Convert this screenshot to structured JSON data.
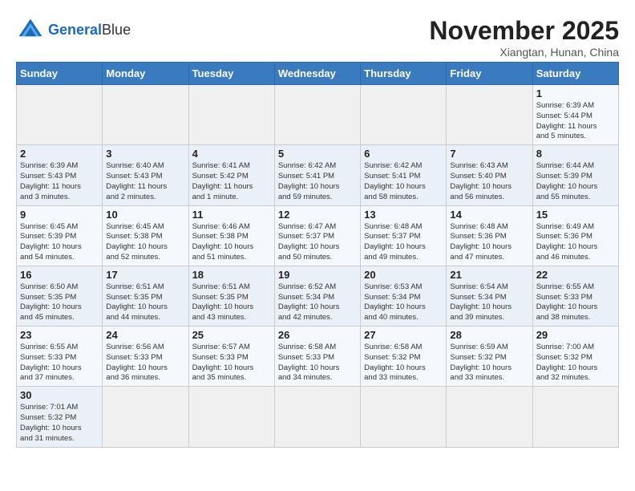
{
  "header": {
    "logo_general": "General",
    "logo_blue": "Blue",
    "month_title": "November 2025",
    "location": "Xiangtan, Hunan, China"
  },
  "weekdays": [
    "Sunday",
    "Monday",
    "Tuesday",
    "Wednesday",
    "Thursday",
    "Friday",
    "Saturday"
  ],
  "weeks": [
    [
      {
        "day": "",
        "info": ""
      },
      {
        "day": "",
        "info": ""
      },
      {
        "day": "",
        "info": ""
      },
      {
        "day": "",
        "info": ""
      },
      {
        "day": "",
        "info": ""
      },
      {
        "day": "",
        "info": ""
      },
      {
        "day": "1",
        "info": "Sunrise: 6:39 AM\nSunset: 5:44 PM\nDaylight: 11 hours\nand 5 minutes."
      }
    ],
    [
      {
        "day": "2",
        "info": "Sunrise: 6:39 AM\nSunset: 5:43 PM\nDaylight: 11 hours\nand 3 minutes."
      },
      {
        "day": "3",
        "info": "Sunrise: 6:40 AM\nSunset: 5:43 PM\nDaylight: 11 hours\nand 2 minutes."
      },
      {
        "day": "4",
        "info": "Sunrise: 6:41 AM\nSunset: 5:42 PM\nDaylight: 11 hours\nand 1 minute."
      },
      {
        "day": "5",
        "info": "Sunrise: 6:42 AM\nSunset: 5:41 PM\nDaylight: 10 hours\nand 59 minutes."
      },
      {
        "day": "6",
        "info": "Sunrise: 6:42 AM\nSunset: 5:41 PM\nDaylight: 10 hours\nand 58 minutes."
      },
      {
        "day": "7",
        "info": "Sunrise: 6:43 AM\nSunset: 5:40 PM\nDaylight: 10 hours\nand 56 minutes."
      },
      {
        "day": "8",
        "info": "Sunrise: 6:44 AM\nSunset: 5:39 PM\nDaylight: 10 hours\nand 55 minutes."
      }
    ],
    [
      {
        "day": "9",
        "info": "Sunrise: 6:45 AM\nSunset: 5:39 PM\nDaylight: 10 hours\nand 54 minutes."
      },
      {
        "day": "10",
        "info": "Sunrise: 6:45 AM\nSunset: 5:38 PM\nDaylight: 10 hours\nand 52 minutes."
      },
      {
        "day": "11",
        "info": "Sunrise: 6:46 AM\nSunset: 5:38 PM\nDaylight: 10 hours\nand 51 minutes."
      },
      {
        "day": "12",
        "info": "Sunrise: 6:47 AM\nSunset: 5:37 PM\nDaylight: 10 hours\nand 50 minutes."
      },
      {
        "day": "13",
        "info": "Sunrise: 6:48 AM\nSunset: 5:37 PM\nDaylight: 10 hours\nand 49 minutes."
      },
      {
        "day": "14",
        "info": "Sunrise: 6:48 AM\nSunset: 5:36 PM\nDaylight: 10 hours\nand 47 minutes."
      },
      {
        "day": "15",
        "info": "Sunrise: 6:49 AM\nSunset: 5:36 PM\nDaylight: 10 hours\nand 46 minutes."
      }
    ],
    [
      {
        "day": "16",
        "info": "Sunrise: 6:50 AM\nSunset: 5:35 PM\nDaylight: 10 hours\nand 45 minutes."
      },
      {
        "day": "17",
        "info": "Sunrise: 6:51 AM\nSunset: 5:35 PM\nDaylight: 10 hours\nand 44 minutes."
      },
      {
        "day": "18",
        "info": "Sunrise: 6:51 AM\nSunset: 5:35 PM\nDaylight: 10 hours\nand 43 minutes."
      },
      {
        "day": "19",
        "info": "Sunrise: 6:52 AM\nSunset: 5:34 PM\nDaylight: 10 hours\nand 42 minutes."
      },
      {
        "day": "20",
        "info": "Sunrise: 6:53 AM\nSunset: 5:34 PM\nDaylight: 10 hours\nand 40 minutes."
      },
      {
        "day": "21",
        "info": "Sunrise: 6:54 AM\nSunset: 5:34 PM\nDaylight: 10 hours\nand 39 minutes."
      },
      {
        "day": "22",
        "info": "Sunrise: 6:55 AM\nSunset: 5:33 PM\nDaylight: 10 hours\nand 38 minutes."
      }
    ],
    [
      {
        "day": "23",
        "info": "Sunrise: 6:55 AM\nSunset: 5:33 PM\nDaylight: 10 hours\nand 37 minutes."
      },
      {
        "day": "24",
        "info": "Sunrise: 6:56 AM\nSunset: 5:33 PM\nDaylight: 10 hours\nand 36 minutes."
      },
      {
        "day": "25",
        "info": "Sunrise: 6:57 AM\nSunset: 5:33 PM\nDaylight: 10 hours\nand 35 minutes."
      },
      {
        "day": "26",
        "info": "Sunrise: 6:58 AM\nSunset: 5:33 PM\nDaylight: 10 hours\nand 34 minutes."
      },
      {
        "day": "27",
        "info": "Sunrise: 6:58 AM\nSunset: 5:32 PM\nDaylight: 10 hours\nand 33 minutes."
      },
      {
        "day": "28",
        "info": "Sunrise: 6:59 AM\nSunset: 5:32 PM\nDaylight: 10 hours\nand 33 minutes."
      },
      {
        "day": "29",
        "info": "Sunrise: 7:00 AM\nSunset: 5:32 PM\nDaylight: 10 hours\nand 32 minutes."
      }
    ],
    [
      {
        "day": "30",
        "info": "Sunrise: 7:01 AM\nSunset: 5:32 PM\nDaylight: 10 hours\nand 31 minutes."
      },
      {
        "day": "",
        "info": ""
      },
      {
        "day": "",
        "info": ""
      },
      {
        "day": "",
        "info": ""
      },
      {
        "day": "",
        "info": ""
      },
      {
        "day": "",
        "info": ""
      },
      {
        "day": "",
        "info": ""
      }
    ]
  ]
}
